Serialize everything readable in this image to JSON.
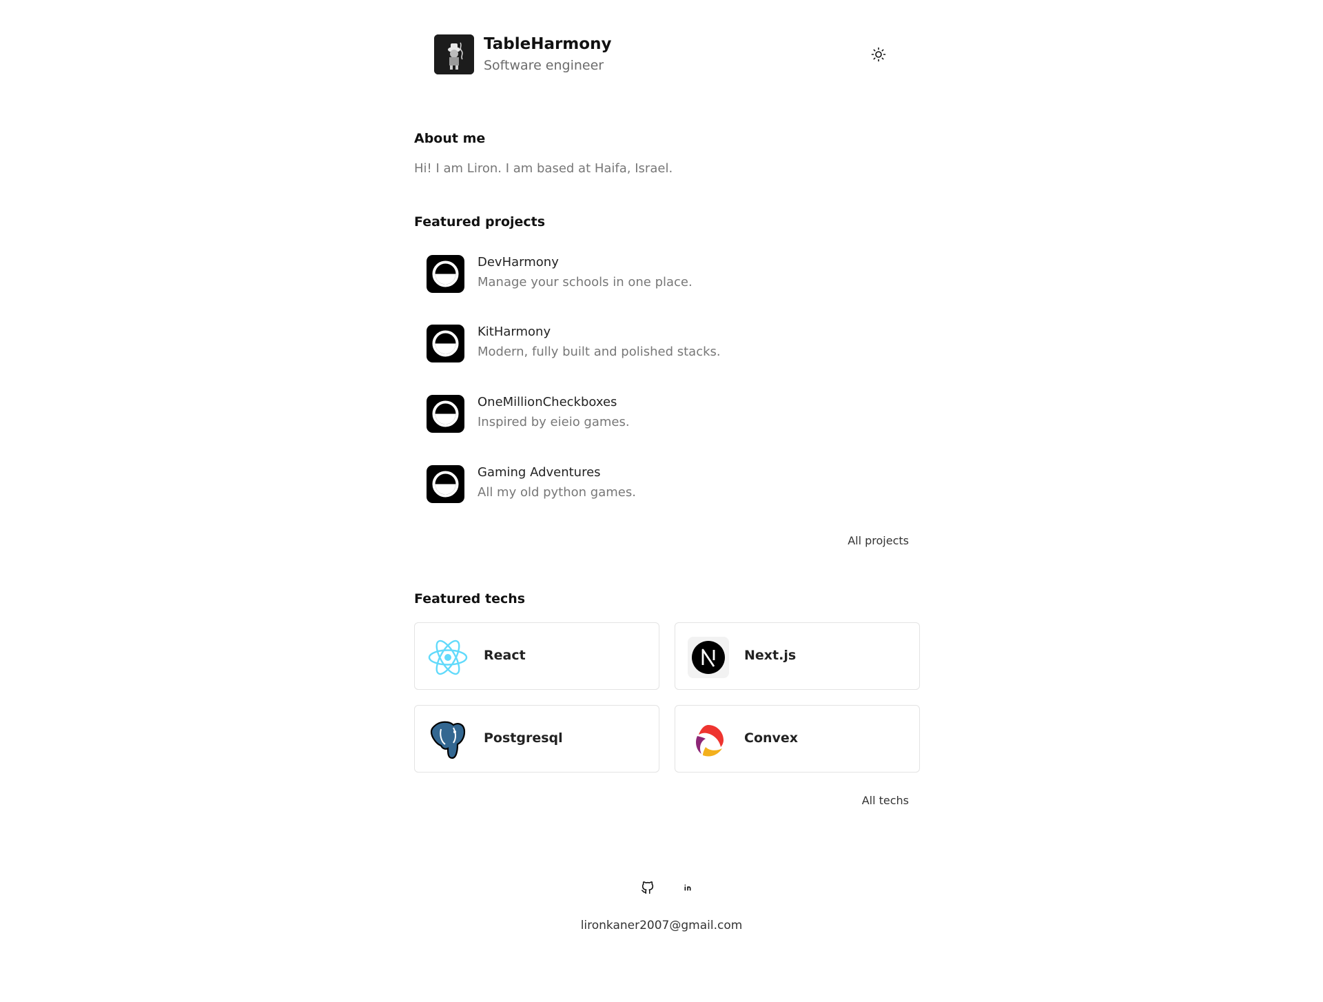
{
  "header": {
    "title": "TableHarmony",
    "subtitle": "Software engineer"
  },
  "about": {
    "heading": "About me",
    "text": "Hi! I am Liron. I am based at Haifa, Israel."
  },
  "projects": {
    "heading": "Featured projects",
    "items": [
      {
        "name": "DevHarmony",
        "description": "Manage your schools in one place."
      },
      {
        "name": "KitHarmony",
        "description": "Modern, fully built and polished stacks."
      },
      {
        "name": "OneMillionCheckboxes",
        "description": "Inspired by eieio games."
      },
      {
        "name": "Gaming Adventures",
        "description": "All my old python games."
      }
    ],
    "all_link": "All projects"
  },
  "techs": {
    "heading": "Featured techs",
    "items": [
      {
        "name": "React",
        "icon": "react-icon",
        "color": "#61dafb"
      },
      {
        "name": "Next.js",
        "icon": "nextjs-icon",
        "color": "#000000"
      },
      {
        "name": "Postgresql",
        "icon": "postgresql-icon",
        "color": "#336791"
      },
      {
        "name": "Convex",
        "icon": "convex-icon",
        "color": "#ee342f"
      }
    ],
    "all_link": "All techs"
  },
  "footer": {
    "social": [
      {
        "icon": "github-icon"
      },
      {
        "icon": "linkedin-icon"
      }
    ],
    "email": "lironkaner2007@gmail.com"
  }
}
